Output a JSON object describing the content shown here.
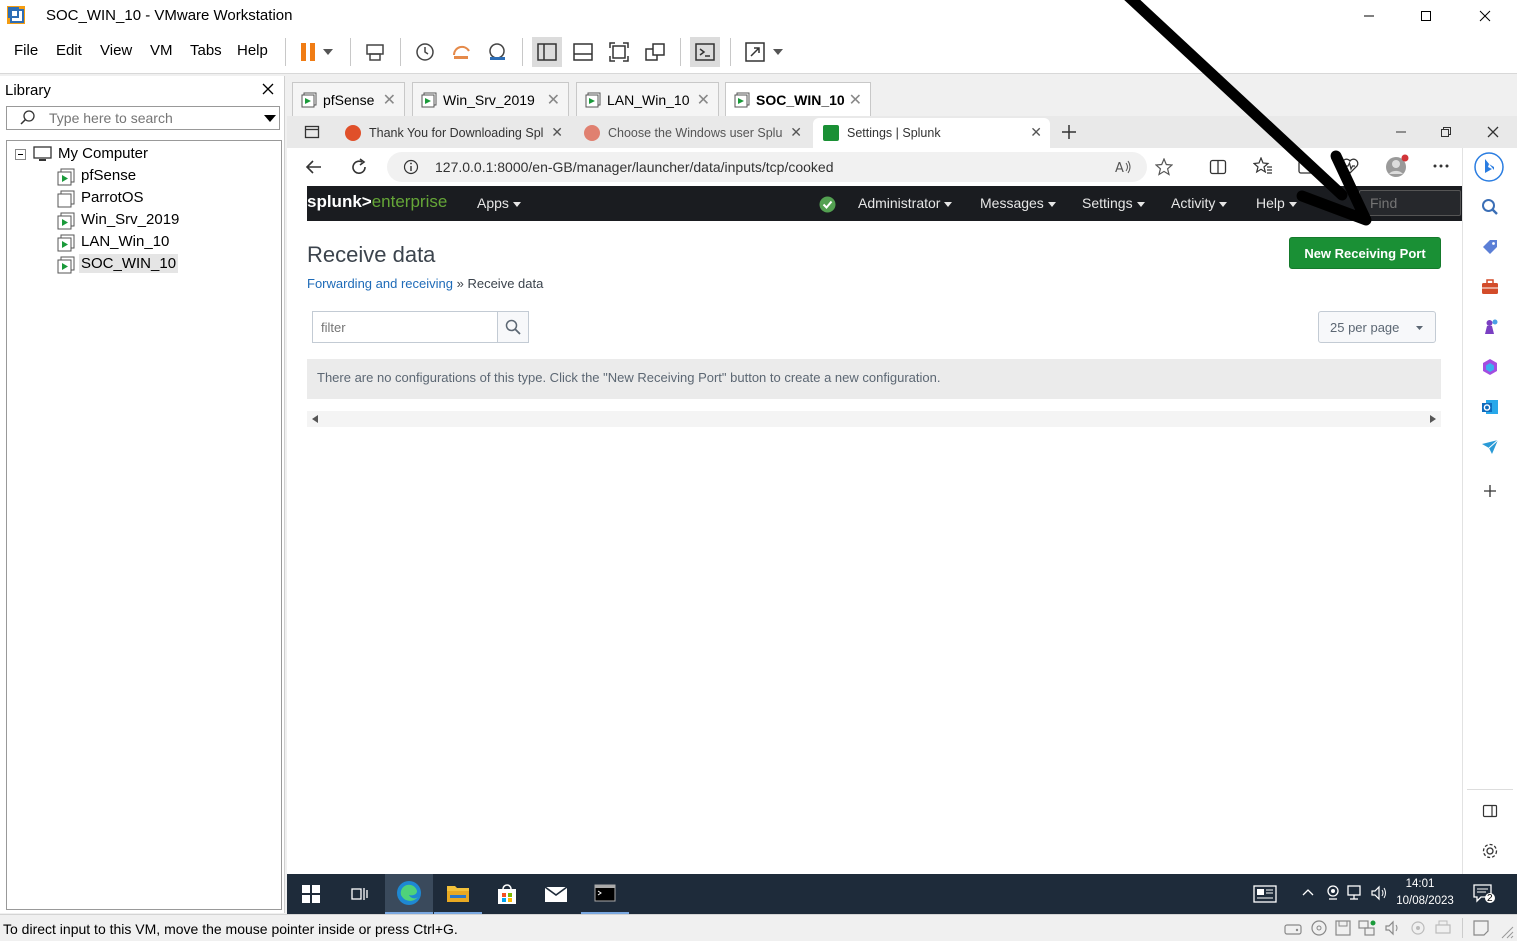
{
  "window": {
    "title": "SOC_WIN_10 - VMware Workstation"
  },
  "menu": [
    "File",
    "Edit",
    "View",
    "VM",
    "Tabs",
    "Help"
  ],
  "library": {
    "header": "Library",
    "search_placeholder": "Type here to search",
    "root": "My Computer",
    "items": [
      "pfSense",
      "ParrotOS",
      "Win_Srv_2019",
      "LAN_Win_10",
      "SOC_WIN_10"
    ]
  },
  "vm_tabs": [
    "pfSense",
    "Win_Srv_2019",
    "LAN_Win_10",
    "SOC_WIN_10"
  ],
  "browser": {
    "tabs": [
      {
        "label": "Thank You for Downloading Splu",
        "color": "#e0502a"
      },
      {
        "label": "Choose the Windows user Splunk",
        "color": "#e08070"
      },
      {
        "label": "Settings | Splunk",
        "color": "#1a9035"
      }
    ],
    "url": "127.0.0.1:8000/en-GB/manager/launcher/data/inputs/tcp/cooked"
  },
  "splunk": {
    "logo_a": "splunk>",
    "logo_b": "enterprise",
    "nav": {
      "apps": "Apps",
      "administrator": "Administrator",
      "messages": "Messages",
      "settings": "Settings",
      "activity": "Activity",
      "help": "Help",
      "find": "Find"
    },
    "page_title": "Receive data",
    "breadcrumb_link": "Forwarding and receiving",
    "breadcrumb_sep": "»",
    "breadcrumb_current": "Receive data",
    "new_button": "New Receiving Port",
    "filter_placeholder": "filter",
    "per_page": "25 per page",
    "empty_message": "There are no configurations of this type. Click the \"New Receiving Port\" button to create a new configuration."
  },
  "taskbar": {
    "time": "14:01",
    "date": "10/08/2023",
    "notifications": "2"
  },
  "status": {
    "text": "To direct input to this VM, move the mouse pointer inside or press Ctrl+G."
  },
  "colors": {
    "splunk_green": "#1a9035",
    "splunk_bar": "#1a1c20",
    "taskbar": "#1e2b3a"
  }
}
